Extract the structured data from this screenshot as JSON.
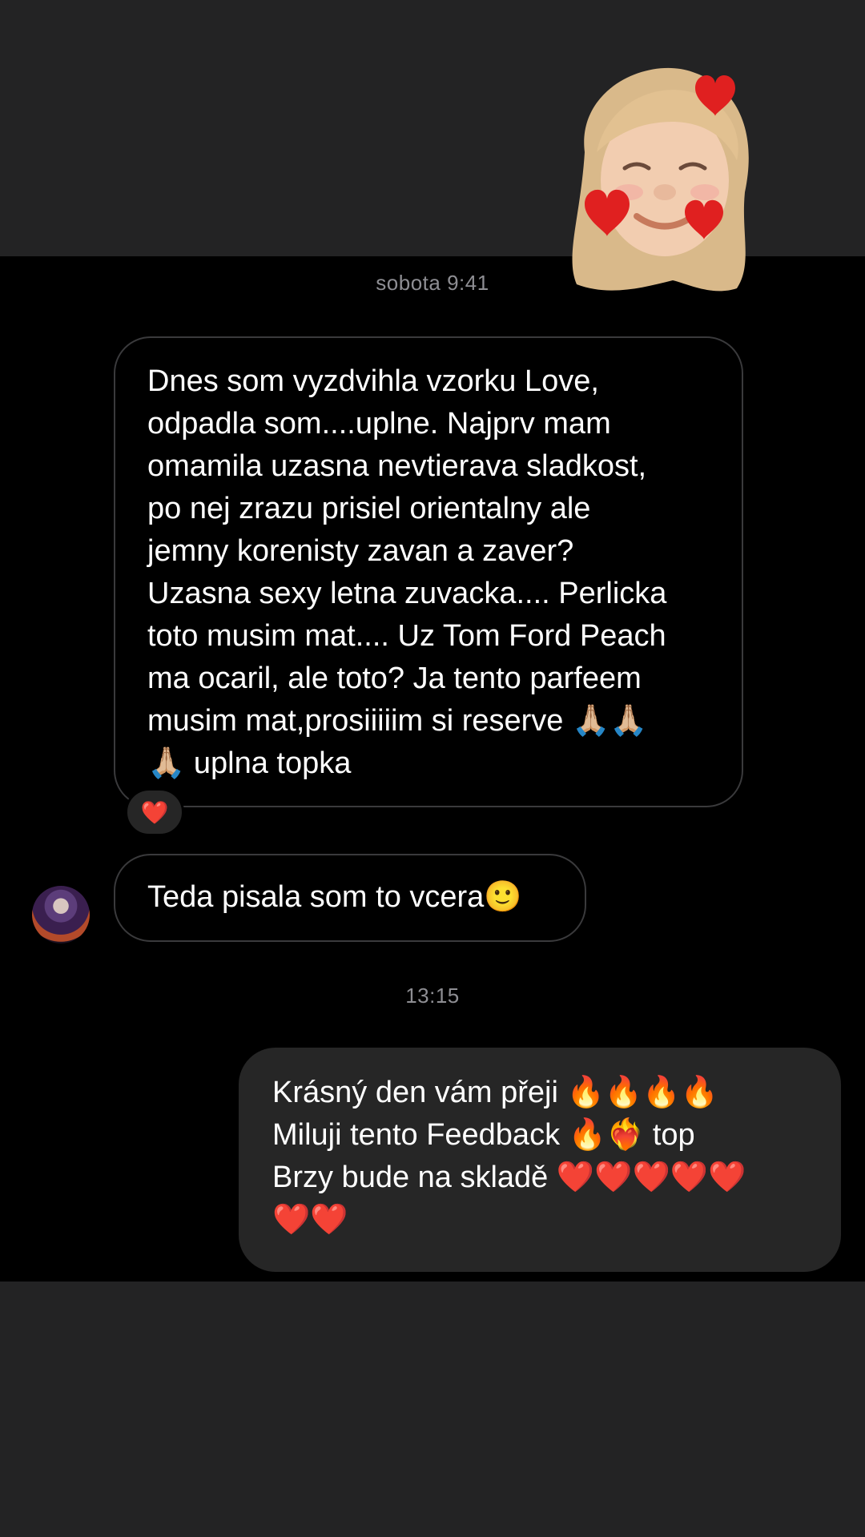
{
  "header": {
    "memoji_icon": "memoji-icon"
  },
  "timestamps": {
    "first": "sobota 9:41",
    "second": "13:15"
  },
  "messages": {
    "incoming_1": "Dnes som vyzdvihla vzorku Love,\nodpadla som....uplne. Najprv mam\nomamila uzasna nevtierava sladkost,\npo nej zrazu prisiel orientalny ale\njemny korenisty zavan a zaver?\nUzasna sexy letna zuvacka.... Perlicka\ntoto musim mat.... Uz Tom Ford Peach\nma ocaril, ale toto? Ja tento parfeem\nmusim mat,prosiiiiim si reserve 🙏🏼🙏🏼\n🙏🏼 uplna topka",
    "reaction": "❤️",
    "incoming_2": "Teda pisala som to vcera🙂",
    "outgoing_1": "Krásný den vám přeji 🔥🔥🔥🔥\nMiluji tento Feedback 🔥❤️‍🔥 top\nBrzy bude na skladě ❤️❤️❤️❤️❤️\n❤️❤️"
  },
  "colors": {
    "chat_background": "#000000",
    "band_background": "#232324",
    "incoming_border": "#3a3a3c",
    "outgoing_bubble": "#262626",
    "timestamp_text": "#8e8e93"
  }
}
